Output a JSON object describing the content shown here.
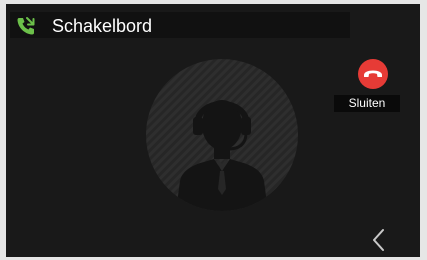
{
  "header": {
    "title": "Schakelbord",
    "icon": "phone-icon",
    "icon_color": "#6cc04a"
  },
  "call": {
    "avatar_icon": "operator-headset-icon",
    "hangup_label": "Sluiten",
    "hangup_icon": "phone-hangup-icon",
    "hangup_color": "#e63b36"
  },
  "nav": {
    "back_icon": "chevron-left-icon"
  }
}
